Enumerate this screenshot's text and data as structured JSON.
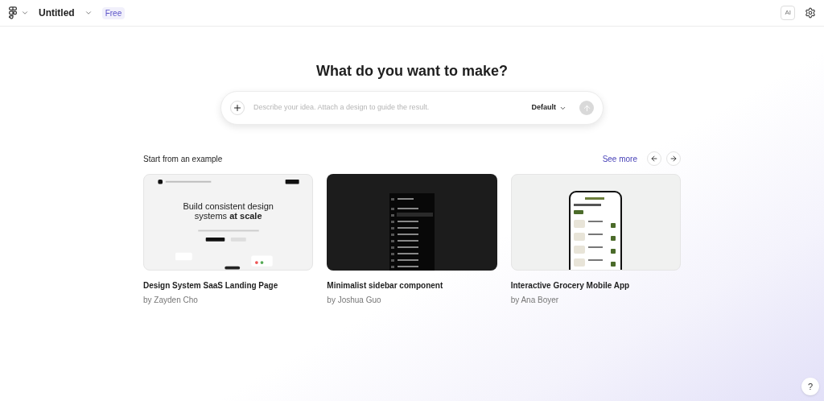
{
  "header": {
    "file_name": "Untitled",
    "plan_badge": "Free",
    "ai_badge": "AI"
  },
  "heading": "What do you want to make?",
  "prompt": {
    "placeholder": "Describe your idea. Attach a design to guide the result.",
    "model": "Default",
    "send_disabled": true
  },
  "examples": {
    "title": "Start from an example",
    "see_more": "See more",
    "items": [
      {
        "kind": "landing",
        "headline": "Build consistent design systems **at scale**",
        "title": "Design System SaaS Landing Page",
        "author": "by Zayden Cho"
      },
      {
        "kind": "sidebar",
        "title": "Minimalist sidebar component",
        "author": "by Joshua Guo"
      },
      {
        "kind": "mobile",
        "title": "Interactive Grocery Mobile App",
        "author": "by Ana Boyer"
      }
    ]
  },
  "help": "?"
}
